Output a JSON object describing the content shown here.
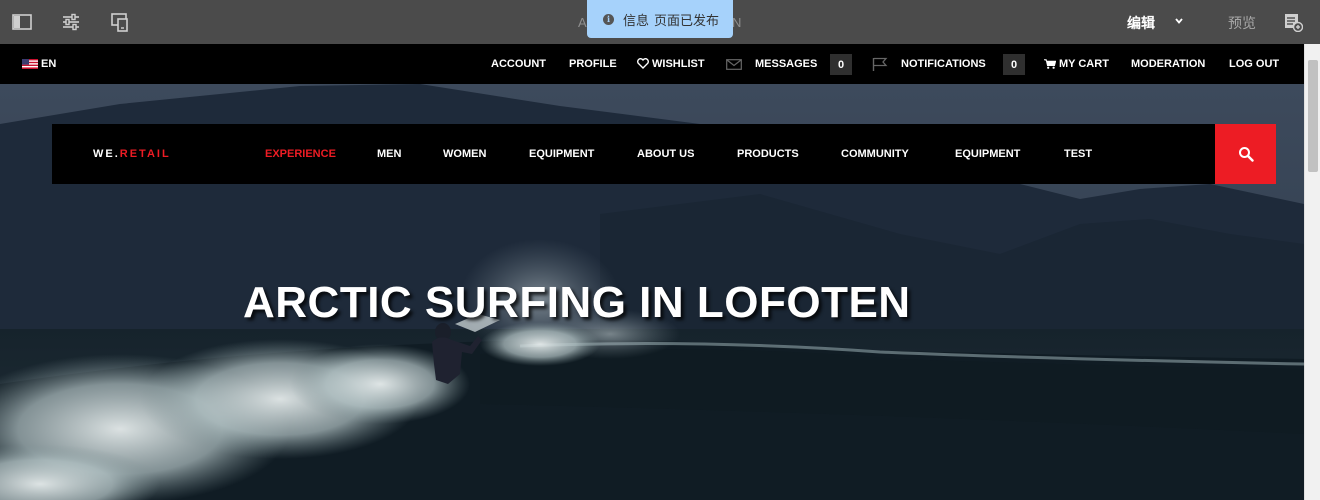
{
  "editor": {
    "title_left": "A",
    "title_right": "N",
    "toast": {
      "label": "信息",
      "message": "页面已发布"
    },
    "mode": "编辑",
    "preview": "预览",
    "icons": [
      "side-panel-icon",
      "properties-icon",
      "emulator-icon",
      "page-info-icon"
    ]
  },
  "topnav": {
    "language": "EN",
    "items": {
      "account": "ACCOUNT",
      "profile": "PROFILE",
      "wishlist": "WISHLIST",
      "messages": "MESSAGES",
      "messages_count": "0",
      "notifications": "NOTIFICATIONS",
      "notifications_count": "0",
      "cart": "MY CART",
      "moderation": "MODERATION",
      "logout": "LOG OUT"
    }
  },
  "mainnav": {
    "logo_prefix": "WE.",
    "logo_suffix": "RETAIL",
    "items": [
      "EXPERIENCE",
      "MEN",
      "WOMEN",
      "EQUIPMENT",
      "ABOUT US",
      "PRODUCTS",
      "COMMUNITY",
      "EQUIPMENT",
      "TEST"
    ],
    "active_index": 0
  },
  "hero": {
    "title": "ARCTIC SURFING IN LOFOTEN"
  },
  "colors": {
    "accent_red": "#ed1c24",
    "editor_bar": "#4b4b4b",
    "toast_bg": "#a6d2fb"
  }
}
